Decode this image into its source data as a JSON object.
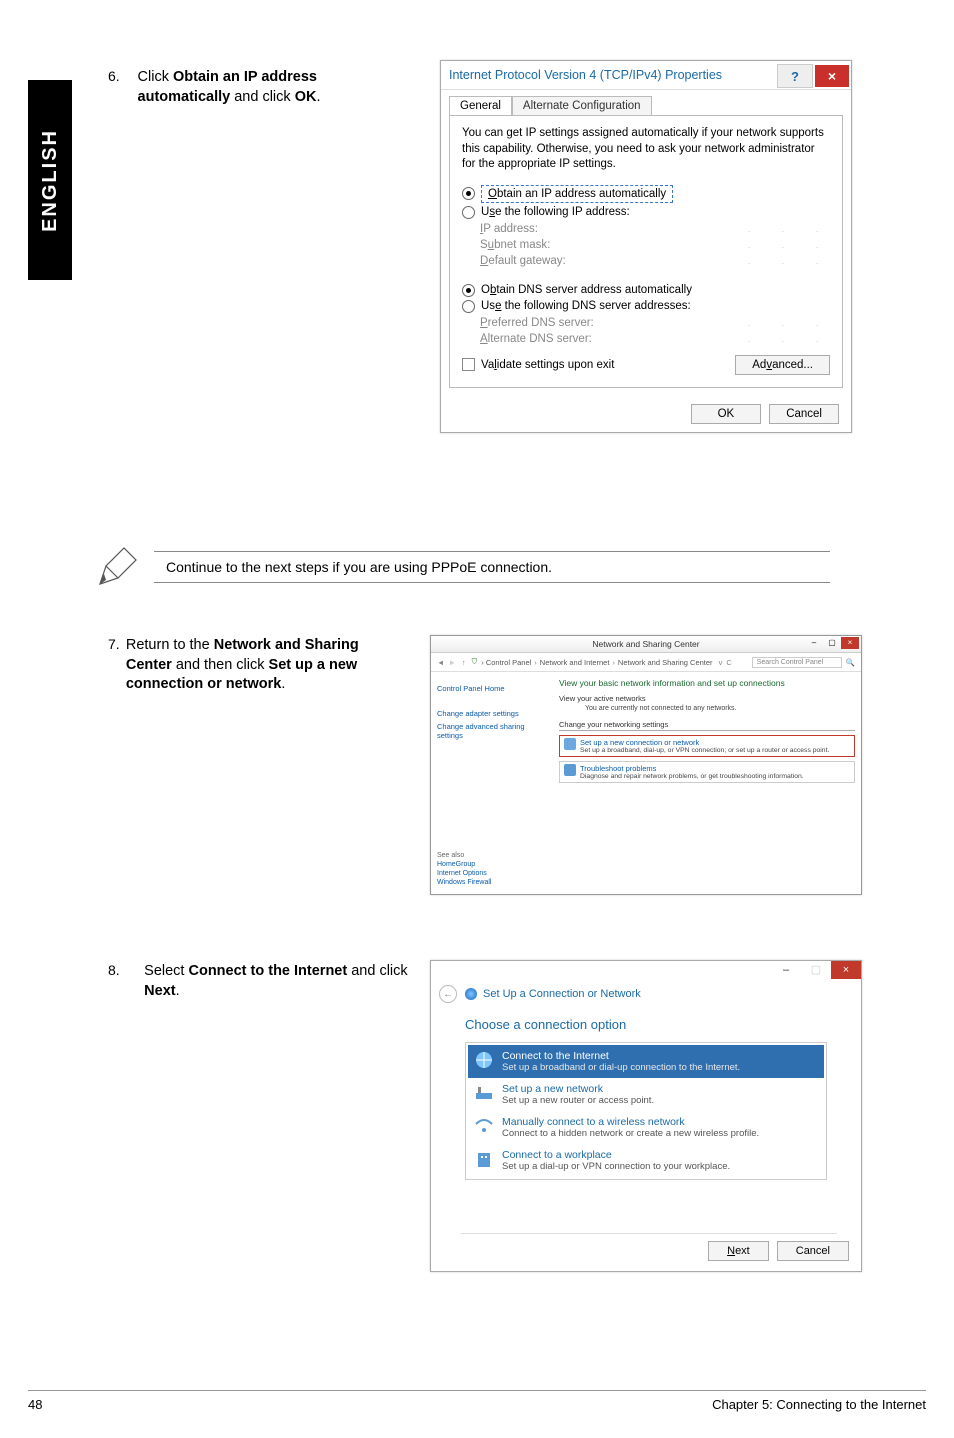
{
  "sidebar": {
    "label": "ENGLISH"
  },
  "steps": {
    "s6": {
      "num": "6.",
      "text_prefix": "Click ",
      "b1": "Obtain an IP address automatically",
      "mid": " and click ",
      "b2": "OK",
      "suffix": "."
    },
    "s7": {
      "num": "7.",
      "text_prefix": "Return to the ",
      "b1": "Network and Sharing Center",
      "mid": " and then click ",
      "b2": "Set up a new connection or network",
      "suffix": "."
    },
    "s8": {
      "num": "8.",
      "text_prefix": "Select ",
      "b1": "Connect to the Internet",
      "mid": " and click ",
      "b2": "Next",
      "suffix": "."
    }
  },
  "note": {
    "text": "Continue to the next steps if you are using PPPoE connection."
  },
  "dialog1": {
    "title": "Internet Protocol Version 4 (TCP/IPv4) Properties",
    "help": "?",
    "close": "×",
    "tabs": {
      "general": "General",
      "alt": "Alternate Configuration"
    },
    "info": "You can get IP settings assigned automatically if your network supports this capability. Otherwise, you need to ask your network administrator for the appropriate IP settings.",
    "r1": "Obtain an IP address automatically",
    "r2": "Use the following IP address:",
    "f_ip": "IP address:",
    "f_mask": "Subnet mask:",
    "f_gw": "Default gateway:",
    "r3": "Obtain DNS server address automatically",
    "r4": "Use the following DNS server addresses:",
    "f_pdns": "Preferred DNS server:",
    "f_adns": "Alternate DNS server:",
    "validate": "Validate settings upon exit",
    "advanced": "Advanced...",
    "ok": "OK",
    "cancel": "Cancel"
  },
  "dialog2": {
    "title": "Network and Sharing Center",
    "crumbs": [
      "Control Panel",
      "Network and Internet",
      "Network and Sharing Center"
    ],
    "search_ph": "Search Control Panel",
    "left": {
      "home": "Control Panel Home",
      "adapter": "Change adapter settings",
      "sharing": "Change advanced sharing settings"
    },
    "right": {
      "hd": "View your basic network information and set up connections",
      "sub1": "View your active networks",
      "sub1_desc": "You are currently not connected to any networks.",
      "sect": "Change your networking settings",
      "opt1_t": "Set up a new connection or network",
      "opt1_d": "Set up a broadband, dial-up, or VPN connection; or set up a router or access point.",
      "opt2_t": "Troubleshoot problems",
      "opt2_d": "Diagnose and repair network problems, or get troubleshooting information."
    },
    "see_also": {
      "label": "See also",
      "items": [
        "HomeGroup",
        "Internet Options",
        "Windows Firewall"
      ]
    }
  },
  "dialog3": {
    "header": "Set Up a Connection or Network",
    "choose": "Choose a connection option",
    "items": [
      {
        "t1": "Connect to the Internet",
        "t2": "Set up a broadband or dial-up connection to the Internet."
      },
      {
        "t1": "Set up a new network",
        "t2": "Set up a new router or access point."
      },
      {
        "t1": "Manually connect to a wireless network",
        "t2": "Connect to a hidden network or create a new wireless profile."
      },
      {
        "t1": "Connect to a workplace",
        "t2": "Set up a dial-up or VPN connection to your workplace."
      }
    ],
    "next": "Next",
    "cancel": "Cancel",
    "close": "×",
    "min": "–"
  },
  "footer": {
    "page": "48",
    "chapter": "Chapter 5: Connecting to the Internet"
  }
}
